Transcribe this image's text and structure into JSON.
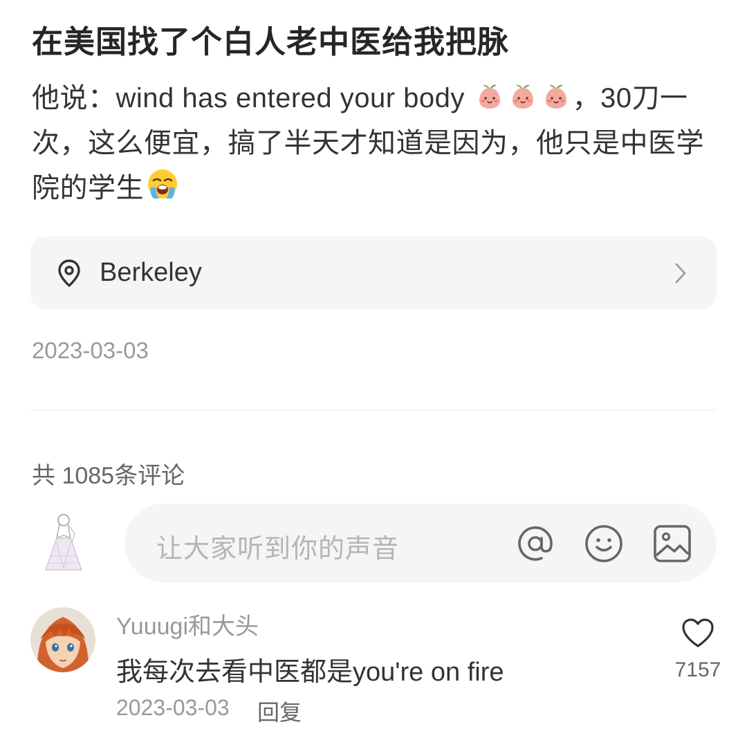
{
  "post": {
    "title": "在美国找了个白人老中医给我把脉",
    "body_part1": "他说：wind has entered your body ",
    "body_part2": "，30刀一次，这么便宜，搞了半天才知道是因为，他只是中医学院的学生",
    "emojis": [
      "peach-face-icon",
      "peach-face-icon",
      "peach-face-icon",
      "loudly-crying-face-icon"
    ],
    "location": "Berkeley",
    "date": "2023-03-03"
  },
  "comments_section": {
    "count_label": "共 1085条评论",
    "input_placeholder": "让大家听到你的声音",
    "input_icons": [
      "at-icon",
      "smile-icon",
      "image-icon"
    ]
  },
  "comments": [
    {
      "username": "Yuuugi和大头",
      "text": "我每次去看中医都是you're on fire",
      "date": "2023-03-03",
      "reply_label": "回复",
      "likes": "7157"
    }
  ],
  "colors": {
    "text_primary": "#262626",
    "text_secondary": "#999999",
    "card_bg": "#f5f5f5",
    "peach": "#f2a59a"
  }
}
